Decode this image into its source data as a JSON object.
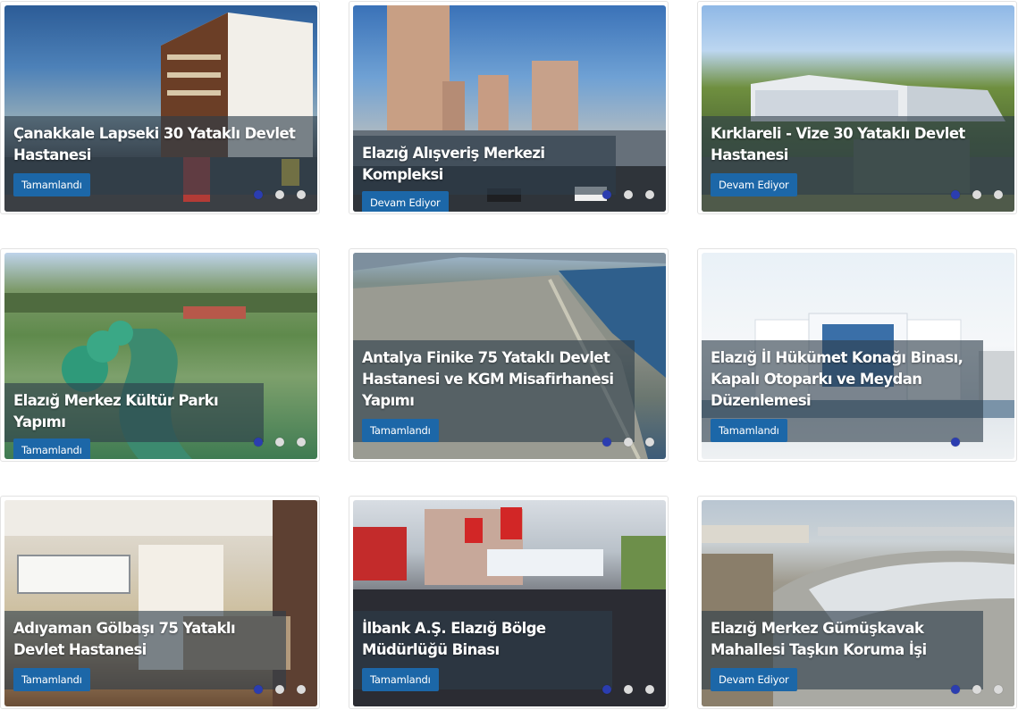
{
  "projects": [
    {
      "title": "Çanakkale Lapseki 30 Yataklı Devlet Hastanesi",
      "status": "Tamamlandı",
      "image": "hospital-building-photo"
    },
    {
      "title": "Elazığ Alışveriş Merkezi Kompleksi",
      "status": "Devam Ediyor",
      "image": "residential-towers-photo"
    },
    {
      "title": "Kırklareli - Vize 30 Yataklı Devlet Hastanesi",
      "status": "Devam Ediyor",
      "image": "hospital-render-photo"
    },
    {
      "title": "Elazığ Merkez Kültür Parkı Yapımı",
      "status": "Tamamlandı",
      "image": "culture-park-aerial-photo"
    },
    {
      "title": "Antalya Finike 75 Yataklı Devlet Hastanesi ve KGM Misafirhanesi Yapımı",
      "status": "Tamamlandı",
      "image": "coastal-town-aerial-photo"
    },
    {
      "title": "Elazığ İl Hükümet Konağı Binası, Kapalı Otoparkı ve Meydan Düzenlemesi",
      "status": "Tamamlandı",
      "image": "government-building-photo"
    },
    {
      "title": "Adıyaman Gölbaşı 75 Yataklı Devlet Hastanesi",
      "status": "Tamamlandı",
      "image": "hospital-interior-photo"
    },
    {
      "title": "İlbank A.Ş. Elazığ Bölge Müdürlüğü Binası",
      "status": "Tamamlandı",
      "image": "ceremony-crowd-photo"
    },
    {
      "title": "Elazığ Merkez Gümüşkavak Mahallesi Taşkın Koruma İşi",
      "status": "Devam Ediyor",
      "image": "flood-channel-photo"
    }
  ]
}
